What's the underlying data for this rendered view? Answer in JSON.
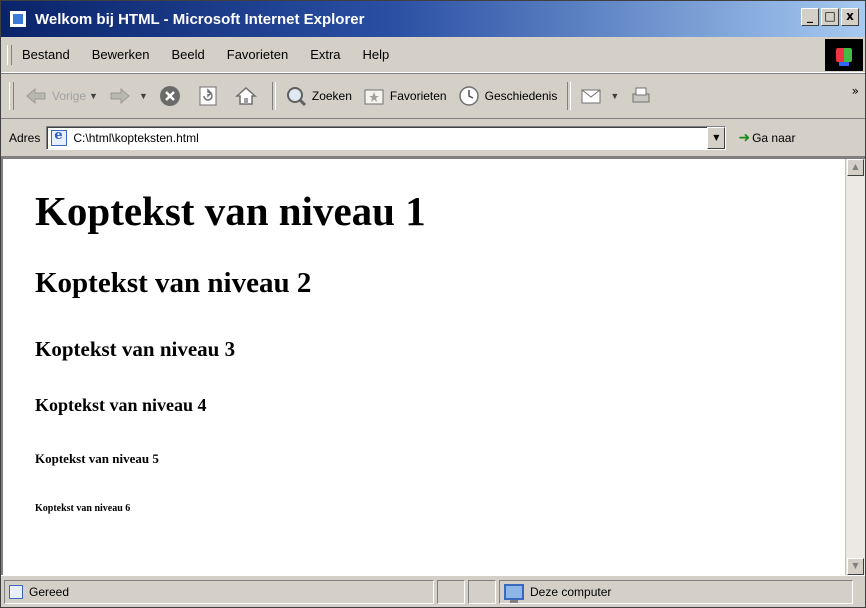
{
  "window": {
    "title": "Welkom bij HTML - Microsoft Internet Explorer",
    "minimize": "_",
    "maximize": "□",
    "close": "x"
  },
  "menu": {
    "items": [
      {
        "label": "Bestand"
      },
      {
        "label": "Bewerken"
      },
      {
        "label": "Beeld"
      },
      {
        "label": "Favorieten"
      },
      {
        "label": "Extra"
      },
      {
        "label": "Help"
      }
    ]
  },
  "toolbar": {
    "back_label": "Vorige",
    "search_label": "Zoeken",
    "favorites_label": "Favorieten",
    "history_label": "Geschiedenis",
    "more": "»",
    "icons": {
      "back": "arrow-left-icon",
      "forward": "arrow-right-icon",
      "stop": "stop-icon",
      "refresh": "refresh-icon",
      "home": "home-icon",
      "search": "search-icon",
      "favorites": "favorites-icon",
      "history": "history-icon",
      "mail": "mail-icon",
      "print": "print-icon"
    }
  },
  "address": {
    "label": "Adres",
    "value": "C:\\html\\kopteksten.html",
    "go_label": "Ga naar"
  },
  "content": {
    "h1": "Koptekst van niveau 1",
    "h2": "Koptekst van niveau 2",
    "h3": "Koptekst van niveau 3",
    "h4": "Koptekst van niveau 4",
    "h5": "Koptekst van niveau 5",
    "h6": "Koptekst van niveau 6"
  },
  "status": {
    "text": "Gereed",
    "zone": "Deze computer"
  },
  "colors": {
    "titlebar_start": "#0a246a",
    "titlebar_end": "#a6caf0",
    "chrome": "#d4d0c8"
  }
}
